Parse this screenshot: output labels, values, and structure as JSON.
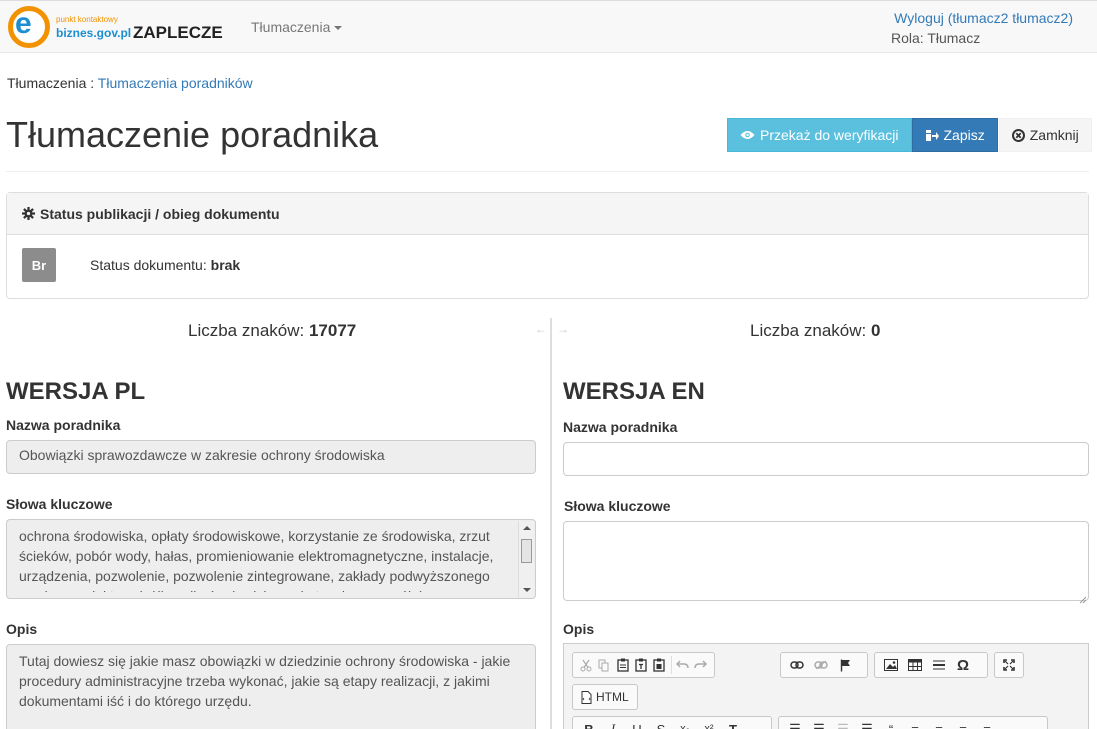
{
  "navbar": {
    "logo_line1": "punkt kontaktowy",
    "logo_line2": "biznes.gov.pl",
    "logo_letter": "e",
    "brand": "ZAPLECZE",
    "menu_label": "Tłumaczenia",
    "logout_text": "Wyloguj (tłumacz2 tłumacz2)",
    "role_text": "Rola: Tłumacz"
  },
  "breadcrumb": {
    "root": "Tłumaczenia",
    "separator": " : ",
    "current": "Tłumaczenia poradników"
  },
  "page": {
    "title": "Tłumaczenie poradnika"
  },
  "actions": {
    "verify_label": "Przekaż do weryfikacji",
    "save_label": "Zapisz",
    "close_label": "Zamknij"
  },
  "status_panel": {
    "heading": "Status publikacji / obieg dokumentu",
    "badge": "Br",
    "status_label": "Status dokumentu:",
    "status_value": "brak"
  },
  "left": {
    "count_label": "Liczba znaków:",
    "count_value": "17077",
    "section_title": "WERSJA PL",
    "name_label": "Nazwa poradnika",
    "name_value": "Obowiązki sprawozdawcze w zakresie ochrony środowiska",
    "keywords_label": "Słowa kluczowe",
    "keywords_value": "ochrona środowiska, opłaty środowiskowe, korzystanie ze środowiska, zrzut ścieków, pobór wody, hałas, promieniowanie elektromagnetyczne, instalacje, urządzenia, pozwolenie, pozwolenie zintegrowane, zakłady podwyższonego ryzyka, produkty uciążliwe dla środowiska, substancje szczególnie",
    "desc_label": "Opis",
    "desc_value": "Tutaj dowiesz się jakie masz obowiązki w dziedzinie ochrony środowiska - jakie procedury administracyjne trzeba wykonać, jakie są etapy realizacji, z jakimi dokumentami iść i do którego urzędu."
  },
  "right": {
    "count_label": "Liczba znaków:",
    "count_value": "0",
    "section_title": "WERSJA EN",
    "name_label": "Nazwa poradnika",
    "name_value": "",
    "keywords_label": "Słowa kluczowe",
    "keywords_value": "",
    "desc_label": "Opis",
    "html_button_label": "HTML"
  },
  "colors": {
    "info": "#5bc0de",
    "primary": "#337ab7",
    "link": "#337ab7",
    "logo_orange": "#f29200",
    "logo_blue": "#1d8fd0"
  }
}
